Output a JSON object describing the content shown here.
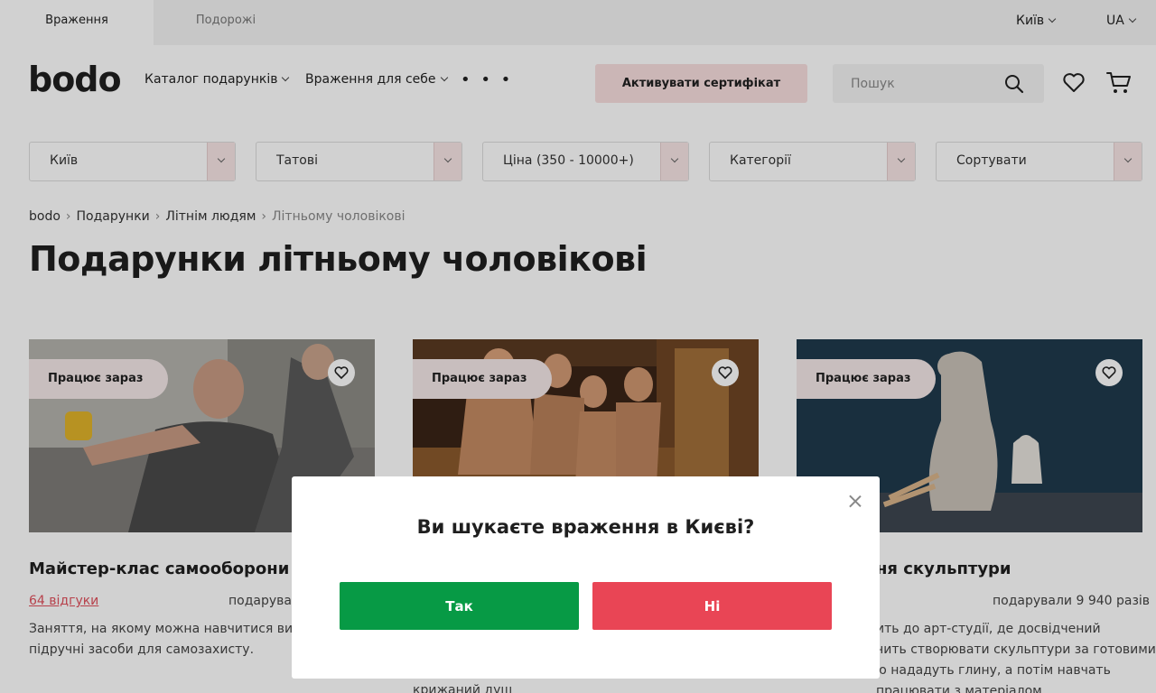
{
  "topbar": {
    "tab_active": "Враження",
    "tab_inactive": "Подорожі",
    "city": "Київ",
    "lang": "UA"
  },
  "header": {
    "logo": "bodo",
    "nav": [
      "Каталог подарунків",
      "Враження для себе"
    ],
    "more": "• • •",
    "activate_label": "Активувати сертифікат",
    "search_placeholder": "Пошук"
  },
  "filters": [
    "Київ",
    "Татові",
    "Ціна (350 - 10000+)",
    "Категорії",
    "Сортувати"
  ],
  "breadcrumb": [
    "bodo",
    "Подарунки",
    "Літнім людям",
    "Літньому чоловікові"
  ],
  "page_title": "Подарунки літньому чоловікові",
  "cards": [
    {
      "badge": "Працює зараз",
      "title": "Майстер-клас самооборони",
      "reviews": "64 відгуки",
      "gifted": "подарува",
      "desc_1": "Заняття, на якому можна навчитися викор",
      "desc_2": "підручні засоби для самозахисту."
    },
    {
      "badge": "Працює зараз",
      "desc_tail": "крижаний душ"
    },
    {
      "badge": "Працює зараз",
      "title": "ня скульптури",
      "gifted": "подарували 9 940 разів",
      "desc_1": "ить до арт-студії, де досвідчений",
      "desc_2": "чить створювати скульптури за готовими",
      "desc_3": "ю нададуть глину, а потім навчать",
      "desc_4": "працювати з матеріалом"
    }
  ],
  "modal": {
    "question": "Ви шукаєте враження в Києві?",
    "yes": "Так",
    "no": "Ні"
  },
  "colors": {
    "accent_pink": "#f8dede",
    "yes_green": "#079a45",
    "no_red": "#e94555",
    "reviews_red": "#e0505c"
  }
}
